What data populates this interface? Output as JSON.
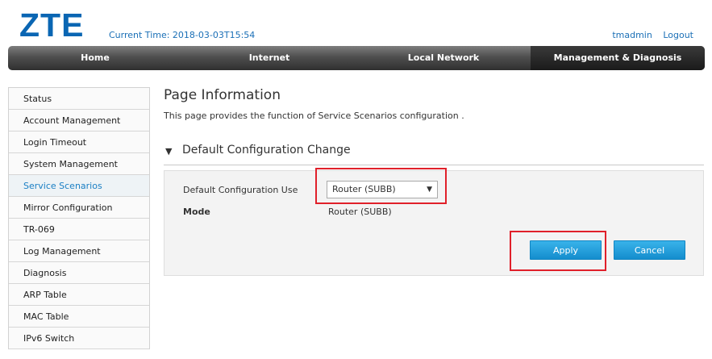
{
  "header": {
    "logo": "ZTE",
    "current_time": "Current Time: 2018-03-03T15:54",
    "username": "tmadmin",
    "logout": "Logout"
  },
  "nav": {
    "tabs": [
      {
        "label": "Home"
      },
      {
        "label": "Internet"
      },
      {
        "label": "Local Network"
      },
      {
        "label": "Management & Diagnosis",
        "active": true
      }
    ]
  },
  "sidebar": {
    "items": [
      {
        "label": "Status"
      },
      {
        "label": "Account Management"
      },
      {
        "label": "Login Timeout"
      },
      {
        "label": "System Management"
      },
      {
        "label": "Service Scenarios",
        "active": true
      },
      {
        "label": "Mirror Configuration"
      },
      {
        "label": "TR-069"
      },
      {
        "label": "Log Management"
      },
      {
        "label": "Diagnosis"
      },
      {
        "label": "ARP Table"
      },
      {
        "label": "MAC Table"
      },
      {
        "label": "IPv6 Switch"
      }
    ]
  },
  "main": {
    "title": "Page Information",
    "description": "This page provides the function of Service Scenarios configuration .",
    "section_title": "Default Configuration Change",
    "section_icon": "triangle-down-icon",
    "config_label": "Default Configuration Use",
    "config_value": "Router (SUBB)",
    "mode_label": "Mode",
    "mode_value": "Router (SUBB)",
    "apply_label": "Apply",
    "cancel_label": "Cancel"
  },
  "colors": {
    "brand": "#0a66b3",
    "link": "#1a6fb6",
    "button": "#1a9ad9",
    "highlight": "#e0202a"
  }
}
